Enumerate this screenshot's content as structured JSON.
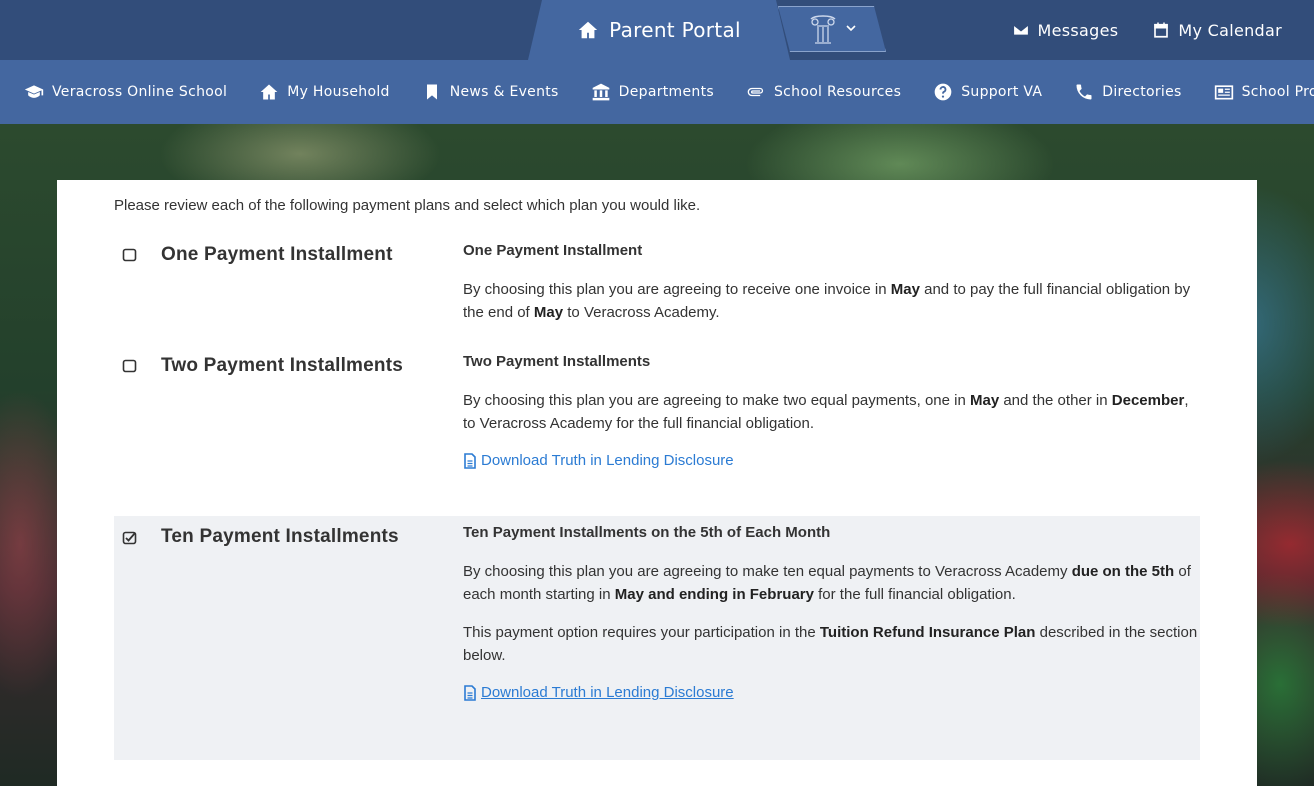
{
  "topbar": {
    "portal_label": "Parent Portal",
    "messages_label": "Messages",
    "calendar_label": "My Calendar"
  },
  "nav": {
    "items": [
      {
        "label": "Veracross Online School",
        "icon": "graduation-cap-icon"
      },
      {
        "label": "My Household",
        "icon": "home-icon"
      },
      {
        "label": "News & Events",
        "icon": "bookmark-icon"
      },
      {
        "label": "Departments",
        "icon": "institution-icon"
      },
      {
        "label": "School Resources",
        "icon": "paperclip-icon"
      },
      {
        "label": "Support VA",
        "icon": "help-circle-icon"
      },
      {
        "label": "Directories",
        "icon": "phone-icon"
      },
      {
        "label": "School Programs",
        "icon": "newspaper-icon"
      }
    ]
  },
  "content": {
    "intro": "Please review each of the following payment plans and select which plan you would like.",
    "plans": [
      {
        "name": "One Payment Installment",
        "checked": false,
        "title": "One Payment Installment",
        "p1": [
          "By choosing this plan you are agreeing to receive one invoice in ",
          "May",
          " and to pay the full financial obligation by the end of ",
          "May",
          " to Veracross Academy."
        ]
      },
      {
        "name": "Two Payment Installments",
        "checked": false,
        "title": "Two Payment Installments",
        "p1": [
          "By choosing this plan you are agreeing to make two equal payments, one in ",
          "May",
          " and the other in ",
          "December",
          ", to Veracross Academy for the full financial obligation."
        ],
        "link": "Download Truth in Lending Disclosure"
      },
      {
        "name": "Ten Payment Installments",
        "checked": true,
        "title": "Ten Payment Installments on the 5th of Each Month",
        "p1": [
          "By choosing this plan you are agreeing to make ten equal payments to Veracross Academy ",
          "due on the 5th",
          " of each month starting in ",
          "May and ending in February",
          " for the full financial obligation."
        ],
        "p2": [
          "This payment option requires your participation in the ",
          "Tuition Refund Insurance Plan",
          " described in the section below."
        ],
        "link": "Download Truth in Lending Disclosure"
      }
    ]
  },
  "colors": {
    "topbar": "#324d7a",
    "navbar": "#4467a0",
    "link": "#2b7bd3",
    "selected_row": "#eff1f4"
  }
}
